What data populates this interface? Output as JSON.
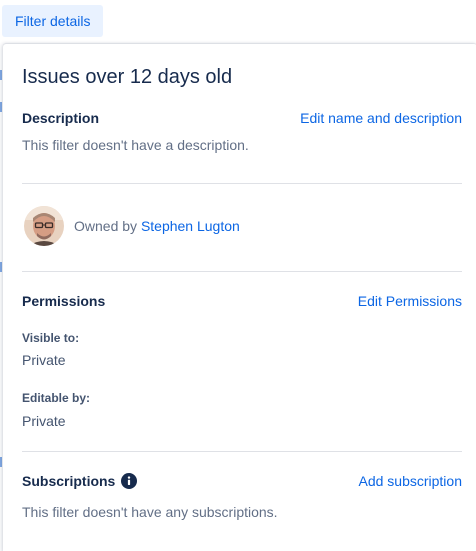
{
  "trigger": {
    "label": "Filter details"
  },
  "filter": {
    "title": "Issues over 12 days old"
  },
  "description": {
    "label": "Description",
    "edit_link": "Edit name and description",
    "empty_text": "This filter doesn't have a description."
  },
  "owner": {
    "prefix": "Owned by",
    "name": "Stephen Lugton",
    "avatar_icon": "user-avatar"
  },
  "permissions": {
    "label": "Permissions",
    "edit_link": "Edit Permissions",
    "visible_label": "Visible to:",
    "visible_value": "Private",
    "editable_label": "Editable by:",
    "editable_value": "Private"
  },
  "subscriptions": {
    "label": "Subscriptions",
    "info_icon": "info-icon",
    "add_link": "Add subscription",
    "empty_text": "This filter doesn't have any subscriptions."
  },
  "colors": {
    "link": "#0c66e4",
    "heading": "#172b4d",
    "muted": "#626f86",
    "button_bg": "#e9f2ff"
  }
}
